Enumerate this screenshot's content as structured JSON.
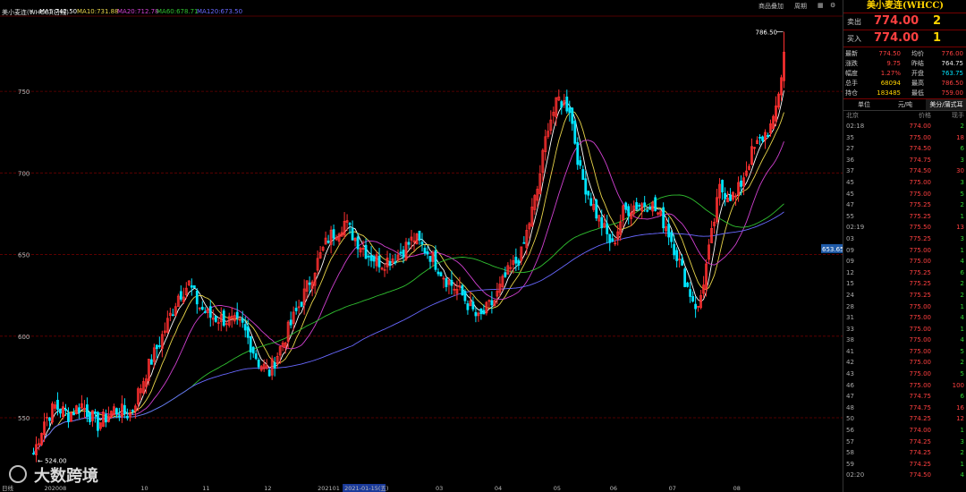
{
  "colors": {
    "up": "#ff3030",
    "down": "#00e5ff",
    "ma5": "#ffffff",
    "ma10": "#e8d44a",
    "ma20": "#d040d0",
    "ma60": "#30c030",
    "ma120": "#6868ff",
    "grid": "#6a0000"
  },
  "header": {
    "title": "美小麦连(WHCC)(日线)",
    "ma5": "MA5:742.50",
    "ma10": "MA10:731.88",
    "ma20": "MA20:712.78",
    "ma60": "MA60:678.71",
    "ma120": "MA120:673.50",
    "btn1": "商品叠加",
    "btn2": "周期"
  },
  "chart_data": {
    "type": "candlestick",
    "ylim": [
      510,
      795
    ],
    "yticks": [
      550,
      600,
      650,
      700,
      750
    ],
    "xlabels": [
      {
        "label": "日线",
        "i": 0
      },
      {
        "label": "202008",
        "i": 4
      },
      {
        "label": "10",
        "i": 40
      },
      {
        "label": "11",
        "i": 63
      },
      {
        "label": "12",
        "i": 86
      },
      {
        "label": "202101",
        "i": 106
      },
      {
        "label": "2021-01-15(五)",
        "i": 116,
        "highlight": true
      },
      {
        "label": "03",
        "i": 150
      },
      {
        "label": "04",
        "i": 172
      },
      {
        "label": "05",
        "i": 194
      },
      {
        "label": "06",
        "i": 215
      },
      {
        "label": "07",
        "i": 237
      },
      {
        "label": "08",
        "i": 261
      }
    ],
    "anchors": [
      [
        0,
        528
      ],
      [
        4,
        548
      ],
      [
        8,
        557
      ],
      [
        13,
        552
      ],
      [
        18,
        558
      ],
      [
        24,
        546
      ],
      [
        30,
        555
      ],
      [
        36,
        552
      ],
      [
        42,
        578
      ],
      [
        48,
        600
      ],
      [
        54,
        625
      ],
      [
        58,
        632
      ],
      [
        62,
        618
      ],
      [
        66,
        612
      ],
      [
        72,
        610
      ],
      [
        78,
        606
      ],
      [
        84,
        584
      ],
      [
        88,
        578
      ],
      [
        94,
        600
      ],
      [
        100,
        622
      ],
      [
        105,
        642
      ],
      [
        110,
        660
      ],
      [
        116,
        670
      ],
      [
        120,
        660
      ],
      [
        125,
        650
      ],
      [
        130,
        645
      ],
      [
        136,
        650
      ],
      [
        142,
        660
      ],
      [
        148,
        650
      ],
      [
        154,
        635
      ],
      [
        160,
        625
      ],
      [
        166,
        610
      ],
      [
        172,
        622
      ],
      [
        176,
        636
      ],
      [
        182,
        650
      ],
      [
        188,
        690
      ],
      [
        192,
        730
      ],
      [
        196,
        745
      ],
      [
        200,
        740
      ],
      [
        204,
        700
      ],
      [
        210,
        675
      ],
      [
        216,
        655
      ],
      [
        220,
        676
      ],
      [
        224,
        680
      ],
      [
        230,
        682
      ],
      [
        236,
        668
      ],
      [
        240,
        650
      ],
      [
        244,
        630
      ],
      [
        248,
        616
      ],
      [
        252,
        652
      ],
      [
        256,
        690
      ],
      [
        262,
        685
      ],
      [
        268,
        712
      ],
      [
        272,
        722
      ],
      [
        276,
        730
      ],
      [
        280,
        770
      ]
    ],
    "last": {
      "open": 756.5,
      "high": 786.5,
      "low": 752,
      "close": 774.0
    },
    "current_price": "653.65",
    "high_label": "786.50",
    "low_label": "524.00"
  },
  "panel": {
    "symbol": "美小麦连(WHCC)",
    "sell_label": "卖出",
    "sell_price": "774.00",
    "sell_vol": "2",
    "buy_label": "买入",
    "buy_price": "774.00",
    "buy_vol": "1",
    "stats": [
      [
        "最新",
        "774.50",
        "均价",
        "776.00"
      ],
      [
        "涨跌",
        "9.75",
        "昨结",
        "764.75"
      ],
      [
        "幅度",
        "1.27%",
        "开盘",
        "763.75"
      ],
      [
        "总手",
        "68094",
        "最高",
        "786.50"
      ],
      [
        "持仓",
        "183485",
        "最低",
        "759.00"
      ]
    ],
    "tab_unit": "单位",
    "tab_yuan": "元/吨",
    "tab_cent": "美分/蒲式耳",
    "tick_headers": [
      "北京",
      "价格",
      "现手"
    ],
    "ticks": [
      [
        "02:18",
        "774.00",
        "2"
      ],
      [
        "35",
        "775.00",
        "18"
      ],
      [
        "27",
        "774.50",
        "6"
      ],
      [
        "36",
        "774.75",
        "3"
      ],
      [
        "37",
        "774.50",
        "30"
      ],
      [
        "45",
        "775.00",
        "3"
      ],
      [
        "45",
        "775.00",
        "5"
      ],
      [
        "47",
        "775.25",
        "2"
      ],
      [
        "55",
        "775.25",
        "1"
      ],
      [
        "02:19",
        "775.50",
        "13"
      ],
      [
        "03",
        "775.25",
        "3"
      ],
      [
        "09",
        "775.00",
        "1"
      ],
      [
        "09",
        "775.00",
        "4"
      ],
      [
        "12",
        "775.25",
        "6"
      ],
      [
        "15",
        "775.25",
        "2"
      ],
      [
        "24",
        "775.25",
        "2"
      ],
      [
        "28",
        "775.00",
        "1"
      ],
      [
        "31",
        "775.00",
        "4"
      ],
      [
        "33",
        "775.00",
        "1"
      ],
      [
        "38",
        "775.00",
        "4"
      ],
      [
        "41",
        "775.00",
        "5"
      ],
      [
        "42",
        "775.00",
        "2"
      ],
      [
        "43",
        "775.00",
        "5"
      ],
      [
        "46",
        "775.00",
        "100"
      ],
      [
        "47",
        "774.75",
        "6"
      ],
      [
        "48",
        "774.75",
        "16"
      ],
      [
        "50",
        "774.25",
        "12"
      ],
      [
        "56",
        "774.00",
        "1"
      ],
      [
        "57",
        "774.25",
        "3"
      ],
      [
        "58",
        "774.25",
        "2"
      ],
      [
        "59",
        "774.25",
        "1"
      ],
      [
        "02:20",
        "774.50",
        "4"
      ]
    ]
  },
  "watermark": "大数跨境"
}
